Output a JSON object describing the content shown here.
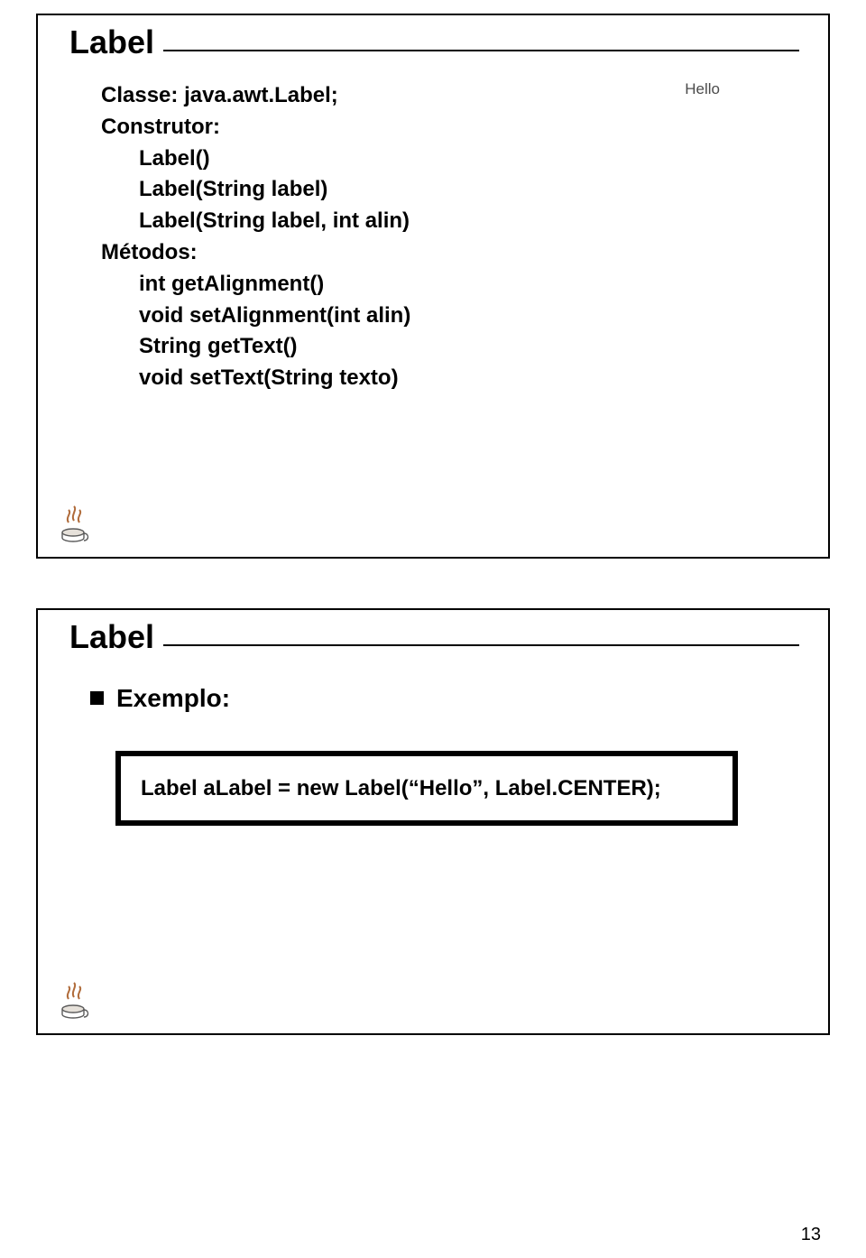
{
  "slide1": {
    "title": "Label",
    "classe_label": "Classe:",
    "classe_value": "java.awt.Label;",
    "construtor_label": "Construtor:",
    "construtores": {
      "c1": "Label()",
      "c2": "Label(String label)",
      "c3": "Label(String label, int alin)"
    },
    "metodos_label": "Métodos:",
    "metodos": {
      "m1": "int getAlignment()",
      "m2": "void setAlignment(int alin)",
      "m3": "String getText()",
      "m4": "void setText(String texto)"
    },
    "illustration_text": "Hello"
  },
  "slide2": {
    "title": "Label",
    "exemplo_label": "Exemplo:",
    "code_line": "Label aLabel = new Label(“Hello”, Label.CENTER);"
  },
  "page_number": "13",
  "icons": {
    "java_cup": "java-cup-icon"
  }
}
